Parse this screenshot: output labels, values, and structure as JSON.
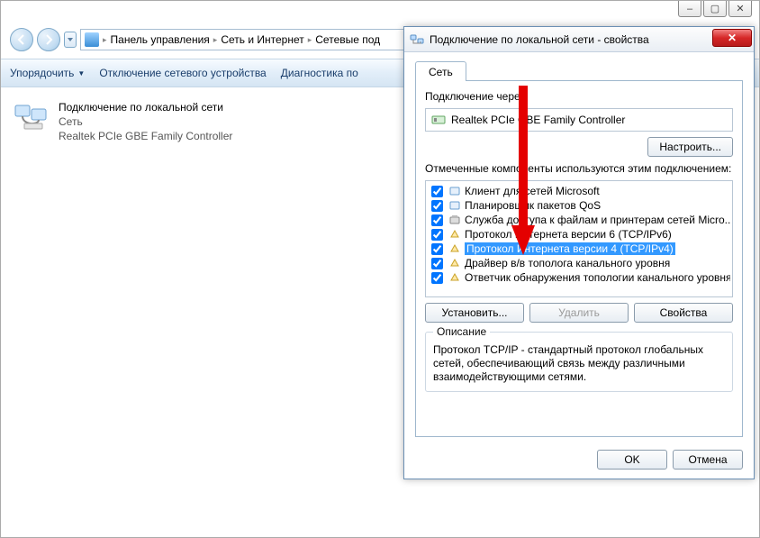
{
  "window_controls": {
    "min": "–",
    "max": "▢",
    "close": "✕"
  },
  "breadcrumb": {
    "items": [
      "Панель управления",
      "Сеть и Интернет",
      "Сетевые под"
    ]
  },
  "toolbar": {
    "organize": "Упорядочить",
    "disable": "Отключение сетевого устройства",
    "diagnose": "Диагностика по"
  },
  "connection": {
    "title": "Подключение по локальной сети",
    "line2": "Сеть",
    "line3": "Realtek PCIe GBE Family Controller"
  },
  "dialog": {
    "title": "Подключение по локальной сети - свойства",
    "tab": "Сеть",
    "connect_via_label": "Подключение через:",
    "adapter": "Realtek PCIe GBE Family Controller",
    "configure_btn": "Настроить...",
    "components_label": "Отмеченные компоненты используются этим подключением:",
    "components": [
      {
        "checked": true,
        "label": "Клиент для сетей Microsoft"
      },
      {
        "checked": true,
        "label": "Планировщик пакетов QoS"
      },
      {
        "checked": true,
        "label": "Служба доступа к файлам и принтерам сетей Micro..."
      },
      {
        "checked": true,
        "label": "Протокол Интернета версии 6 (TCP/IPv6)"
      },
      {
        "checked": true,
        "label": "Протокол Интернета версии 4 (TCP/IPv4)",
        "selected": true
      },
      {
        "checked": true,
        "label": "Драйвер в/в тополога канального уровня"
      },
      {
        "checked": true,
        "label": "Ответчик обнаружения топологии канального уровня"
      }
    ],
    "install_btn": "Установить...",
    "remove_btn": "Удалить",
    "properties_btn": "Свойства",
    "desc_legend": "Описание",
    "desc_text": "Протокол TCP/IP - стандартный протокол глобальных сетей, обеспечивающий связь между различными взаимодействующими сетями.",
    "ok": "OK",
    "cancel": "Отмена"
  }
}
